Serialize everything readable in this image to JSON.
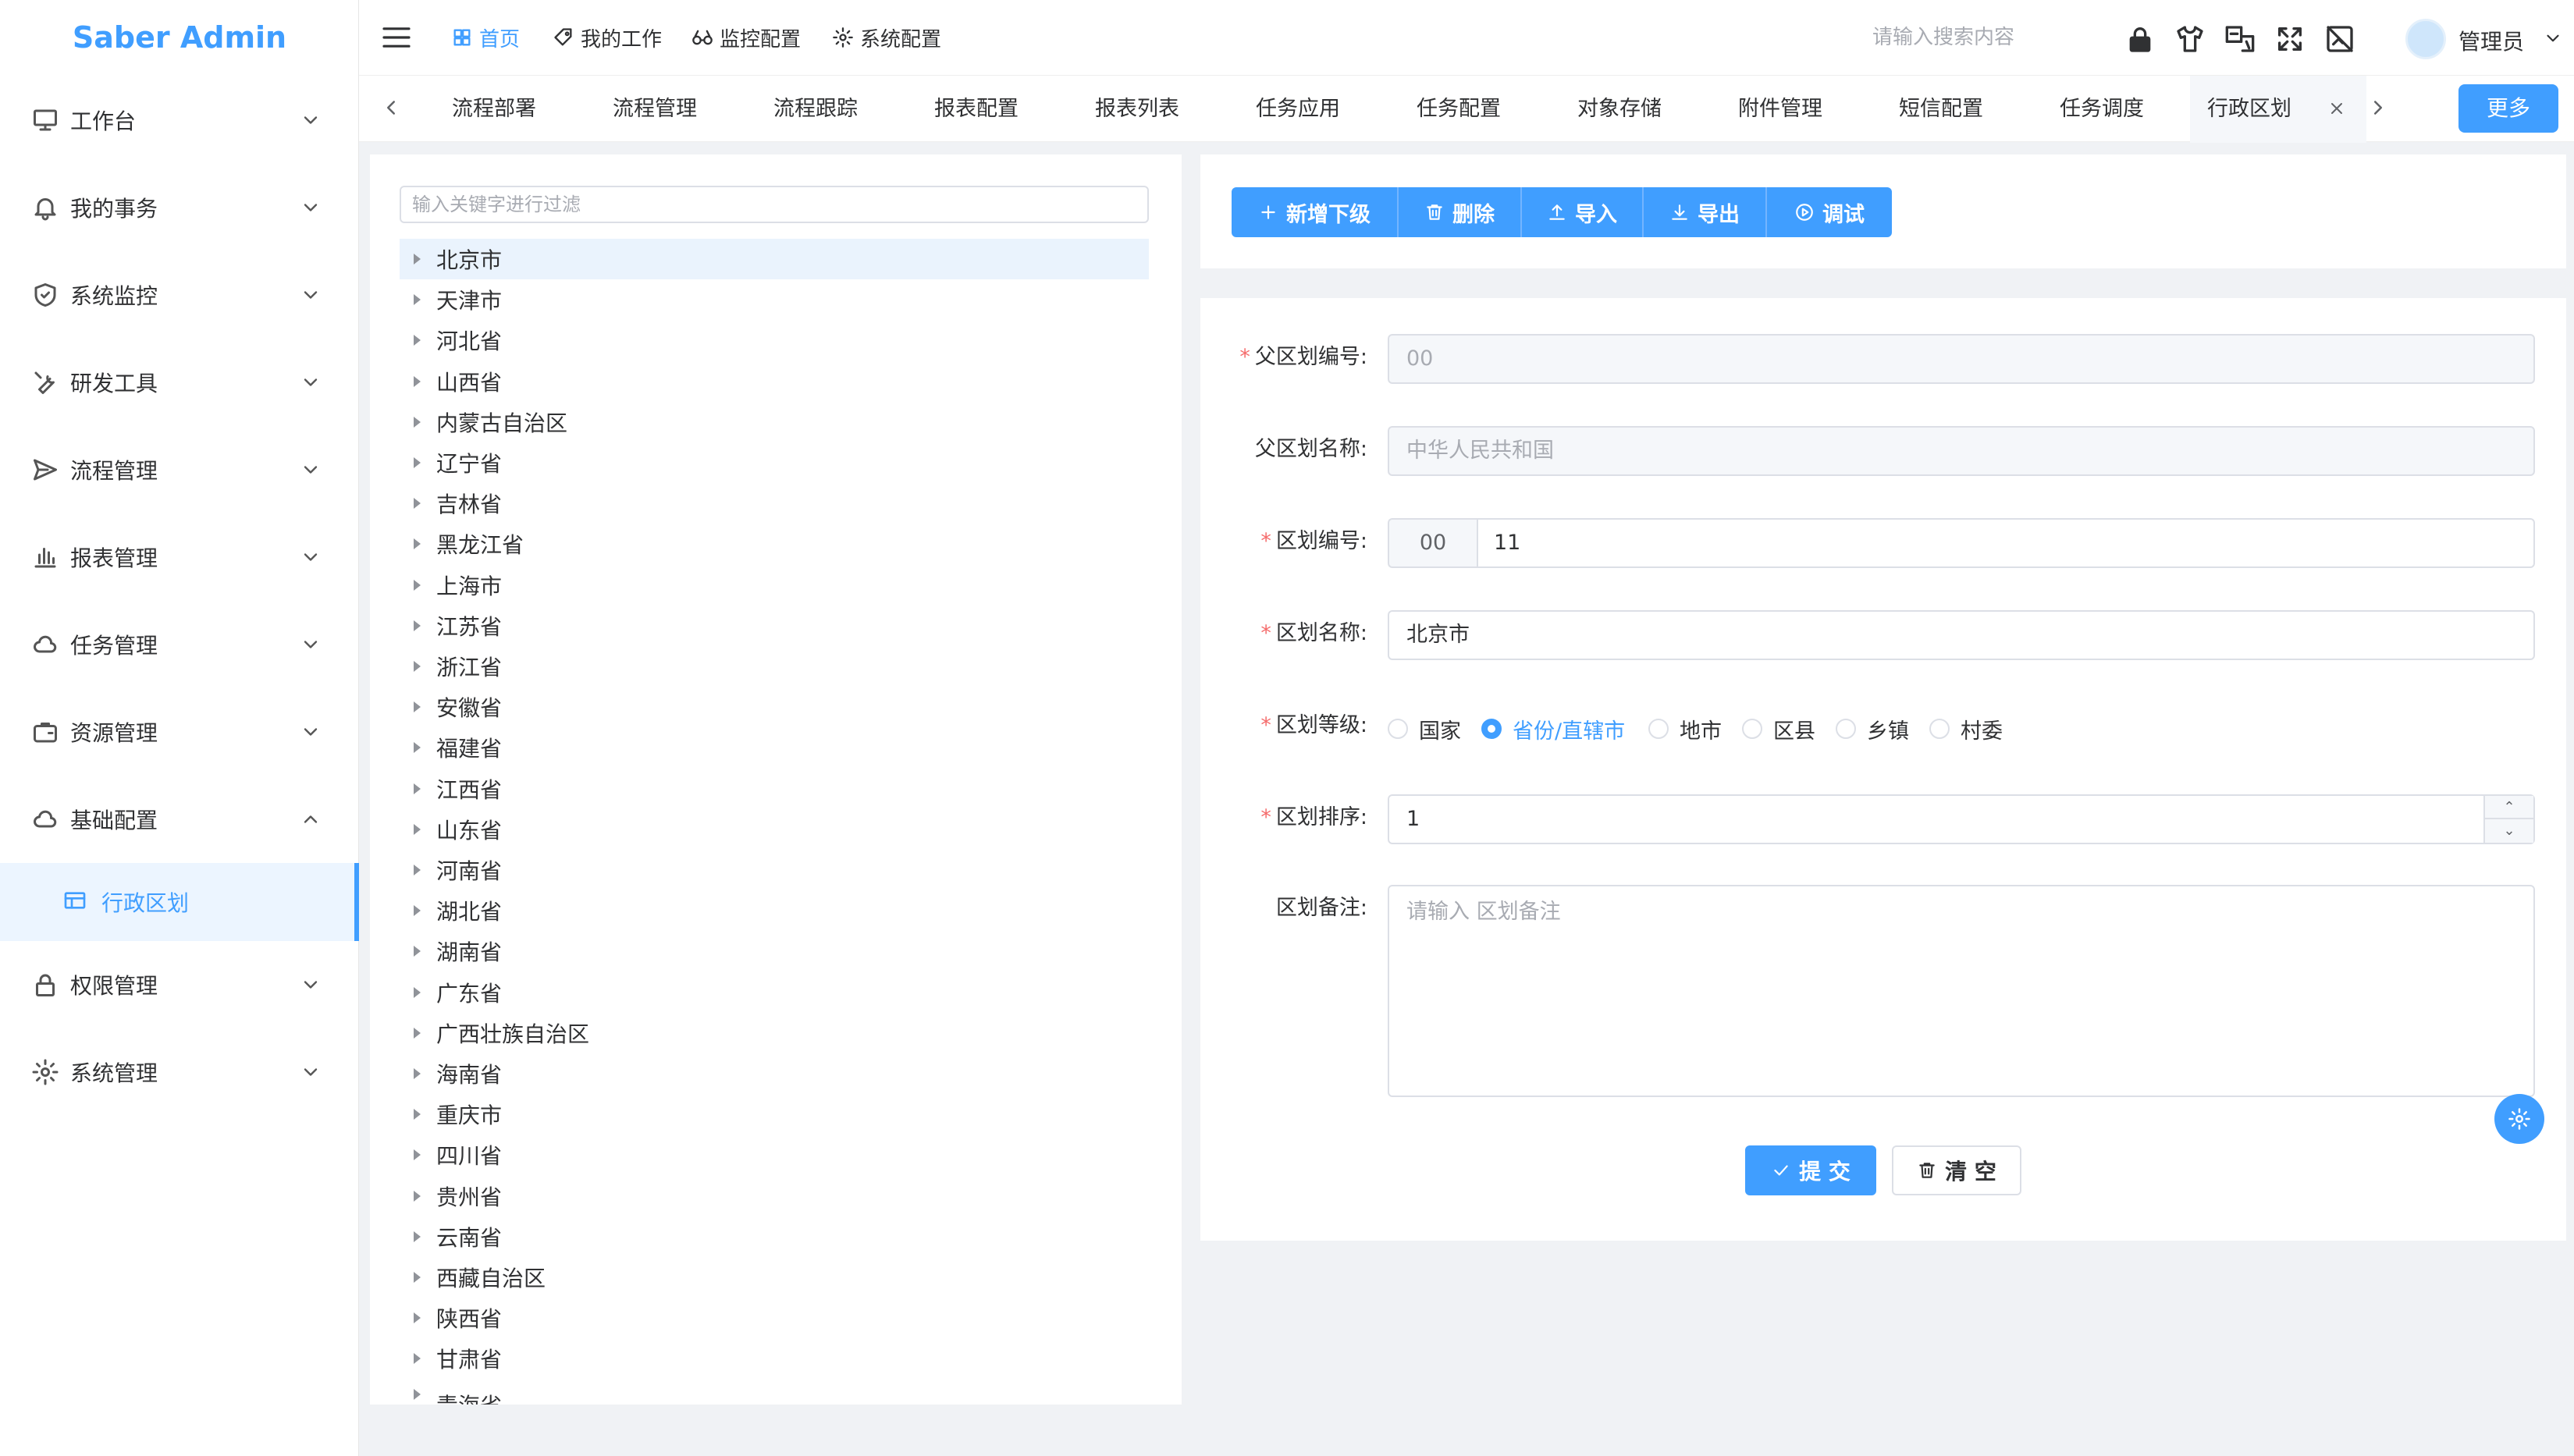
{
  "app": {
    "title": "Saber Admin"
  },
  "sidebar": {
    "items": [
      {
        "label": "工作台",
        "icon": "monitor-icon"
      },
      {
        "label": "我的事务",
        "icon": "bell-icon"
      },
      {
        "label": "系统监控",
        "icon": "shield-icon"
      },
      {
        "label": "研发工具",
        "icon": "wrench-icon"
      },
      {
        "label": "流程管理",
        "icon": "send-icon"
      },
      {
        "label": "报表管理",
        "icon": "bar-chart-icon"
      },
      {
        "label": "任务管理",
        "icon": "cloud-icon"
      },
      {
        "label": "资源管理",
        "icon": "briefcase-icon"
      },
      {
        "label": "基础配置",
        "icon": "cloud-icon"
      },
      {
        "label": "行政区划",
        "icon": "table-icon"
      },
      {
        "label": "权限管理",
        "icon": "lock-icon"
      },
      {
        "label": "系统管理",
        "icon": "gear-icon"
      }
    ]
  },
  "header": {
    "nav": [
      {
        "label": "首页",
        "icon": "grid-icon",
        "active": true
      },
      {
        "label": "我的工作",
        "icon": "tag-icon"
      },
      {
        "label": "监控配置",
        "icon": "glasses-icon"
      },
      {
        "label": "系统配置",
        "icon": "gear-icon"
      }
    ],
    "search_placeholder": "请输入搜索内容",
    "user": "管理员"
  },
  "tabs": {
    "items": [
      "流程部署",
      "流程管理",
      "流程跟踪",
      "报表配置",
      "报表列表",
      "任务应用",
      "任务配置",
      "对象存储",
      "附件管理",
      "短信配置",
      "任务调度",
      "行政区划"
    ],
    "active": "行政区划",
    "more_label": "更多"
  },
  "tree": {
    "filter_placeholder": "输入关键字进行过滤",
    "nodes": [
      "北京市",
      "天津市",
      "河北省",
      "山西省",
      "内蒙古自治区",
      "辽宁省",
      "吉林省",
      "黑龙江省",
      "上海市",
      "江苏省",
      "浙江省",
      "安徽省",
      "福建省",
      "江西省",
      "山东省",
      "河南省",
      "湖北省",
      "湖南省",
      "广东省",
      "广西壮族自治区",
      "海南省",
      "重庆市",
      "四川省",
      "贵州省",
      "云南省",
      "西藏自治区",
      "陕西省",
      "甘肃省",
      "青海省"
    ],
    "selected": "北京市"
  },
  "toolbar": {
    "add_child": "新增下级",
    "delete": "删除",
    "import": "导入",
    "export": "导出",
    "debug": "调试"
  },
  "form": {
    "parent_code": {
      "label": "父区划编号:",
      "value": "00"
    },
    "parent_name": {
      "label": "父区划名称:",
      "value": "中华人民共和国"
    },
    "code": {
      "label": "区划编号:",
      "prefix": "00",
      "value": "11"
    },
    "name": {
      "label": "区划名称:",
      "value": "北京市"
    },
    "level": {
      "label": "区划等级:",
      "options": [
        "国家",
        "省份/直辖市",
        "地市",
        "区县",
        "乡镇",
        "村委"
      ],
      "selected": "省份/直辖市"
    },
    "sort": {
      "label": "区划排序:",
      "value": "1"
    },
    "remark": {
      "label": "区划备注:",
      "placeholder": "请输入 区划备注"
    },
    "submit_label": "提 交",
    "clear_label": "清 空"
  },
  "colors": {
    "primary": "#409eff",
    "required": "#f56c6c"
  }
}
